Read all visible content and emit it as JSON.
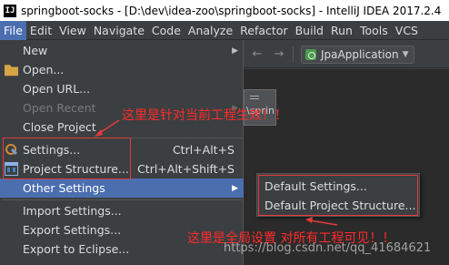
{
  "title_bar": {
    "app_icon": "IJ",
    "title": "springboot-socks - [D:\\dev\\idea-zoo\\springboot-socks] - IntelliJ IDEA 2017.2.4"
  },
  "menu_bar": {
    "file": "File",
    "edit": "Edit",
    "view": "View",
    "navigate": "Navigate",
    "code": "Code",
    "analyze": "Analyze",
    "refactor": "Refactor",
    "build": "Build",
    "run": "Run",
    "tools": "Tools",
    "vcs": "VCS"
  },
  "toolbar": {
    "run_config": "JpaApplication"
  },
  "editor": {
    "tab_label": "\\sprin"
  },
  "file_menu": {
    "new": "New",
    "open": "Open...",
    "open_url": "Open URL...",
    "open_recent": "Open Recent",
    "close_project": "Close Project",
    "settings": "Settings...",
    "settings_shortcut": "Ctrl+Alt+S",
    "project_structure": "Project Structure...",
    "project_structure_shortcut": "Ctrl+Alt+Shift+S",
    "other_settings": "Other Settings",
    "import_settings": "Import Settings...",
    "export_settings": "Export Settings...",
    "export_eclipse": "Export to Eclipse..."
  },
  "other_settings_submenu": {
    "default_settings": "Default Settings...",
    "default_project_structure": "Default Project Structure..."
  },
  "annotations": {
    "current_project_note": "这里是针对当前工程生效！！",
    "global_note": "这里是全局设置 对所有工程可见！！",
    "color": "#ff2a2a"
  },
  "watermark": "https://blog.csdn.net/qq_41684621",
  "colors": {
    "highlight": "#4b6eaf",
    "menu_bg": "#3c3f41",
    "editor_bg": "#2b2b2b"
  }
}
